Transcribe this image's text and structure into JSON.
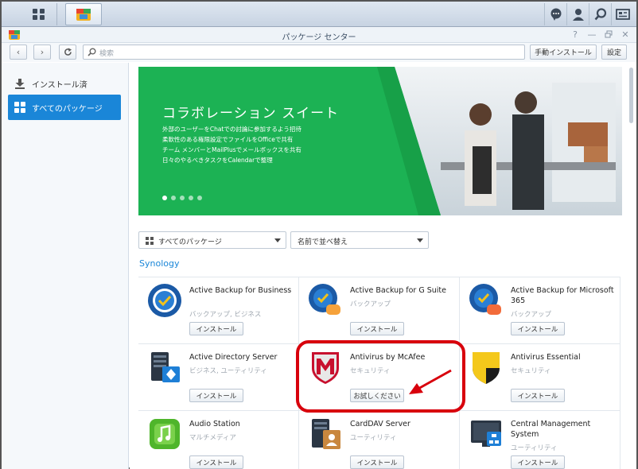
{
  "window": {
    "title": "パッケージ センター"
  },
  "toolbar": {
    "search_placeholder": "検索",
    "manual_install_label": "手動インストール",
    "settings_label": "設定"
  },
  "sidebar": {
    "items": [
      {
        "label": "インストール済",
        "icon": "download-icon"
      },
      {
        "label": "すべてのパッケージ",
        "icon": "grid-icon",
        "selected": true
      }
    ]
  },
  "banner": {
    "title": "コラボレーション スイート",
    "description": [
      "外部のユーザーをChatでの討論に参加するよう招待",
      "柔軟性のある権限設定でファイルをOfficeで共有",
      "チーム メンバーとMailPlusでメールボックスを共有",
      "日々のやるべきタスクをCalendarで整理"
    ],
    "slide_count": 5,
    "active_slide": 1,
    "accent_color": "#1cb254"
  },
  "filters": {
    "category_selected": "すべてのパッケージ",
    "sort_selected": "名前で並べ替え"
  },
  "section": {
    "title": "Synology"
  },
  "packages": [
    {
      "name": "Active Backup for Business",
      "category": "バックアップ, ビジネス",
      "action": "インストール",
      "icon": "active-backup-business-icon"
    },
    {
      "name": "Active Backup for G Suite",
      "category": "バックアップ",
      "action": "インストール",
      "icon": "active-backup-gsuite-icon"
    },
    {
      "name": "Active Backup for Microsoft 365",
      "category": "バックアップ",
      "action": "インストール",
      "icon": "active-backup-m365-icon"
    },
    {
      "name": "Active Directory Server",
      "category": "ビジネス, ユーティリティ",
      "action": "インストール",
      "icon": "active-directory-server-icon"
    },
    {
      "name": "Antivirus by McAfee",
      "category": "セキュリティ",
      "action": "お試しください",
      "icon": "mcafee-shield-icon"
    },
    {
      "name": "Antivirus Essential",
      "category": "セキュリティ",
      "action": "インストール",
      "icon": "antivirus-essential-shield-icon"
    },
    {
      "name": "Audio Station",
      "category": "マルチメディア",
      "action": "インストール",
      "icon": "audio-station-icon"
    },
    {
      "name": "CardDAV Server",
      "category": "ユーティリティ",
      "action": "インストール",
      "icon": "carddav-server-icon"
    },
    {
      "name": "Central Management System",
      "category": "ユーティリティ",
      "action": "インストール",
      "icon": "cms-icon"
    }
  ],
  "annotation": {
    "color": "#d8000c",
    "target": "Antivirus by McAfee"
  }
}
